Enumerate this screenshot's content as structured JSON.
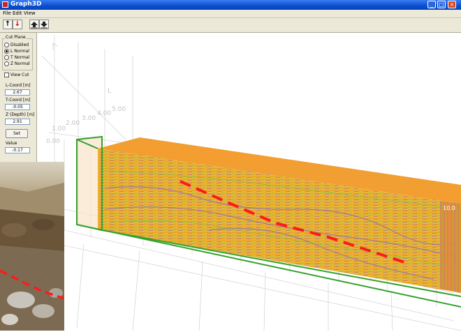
{
  "window": {
    "title": "Graph3D"
  },
  "window_buttons": {
    "minimize": "_",
    "maximize": "□",
    "close": "×"
  },
  "menu": [
    "File",
    "Edit",
    "View"
  ],
  "toolbar": {
    "up_glyph": "↑",
    "down_glyph": "↓"
  },
  "cut_plane": {
    "title": "Cut Plane",
    "options": [
      "Disabled",
      "L Normal",
      "T Normal",
      "Z Normal"
    ],
    "selected": "L Normal",
    "view_cut_label": "View Cut",
    "view_cut_checked": false
  },
  "fields": {
    "l_coord_label": "L-Coord [m]",
    "l_coord_value": "2.67",
    "t_coord_label": "T-Coord [m]",
    "t_coord_value": "-0.05",
    "z_label": "Z (Depth) [m]",
    "z_value": "2.91",
    "set_label": "Set",
    "value_label": "Value",
    "value_value": "-0.17"
  },
  "plot": {
    "axis_l_label": "L",
    "axis_ticks": [
      "0.00",
      "1.00",
      "2.00",
      "3.00",
      "4.00",
      "5.00"
    ],
    "edge_label": "10.0",
    "colors": {
      "surface": "#f39a2c",
      "section": "#f1b82e",
      "frame": "#33a02c",
      "fault": "#ff1a1a"
    }
  }
}
